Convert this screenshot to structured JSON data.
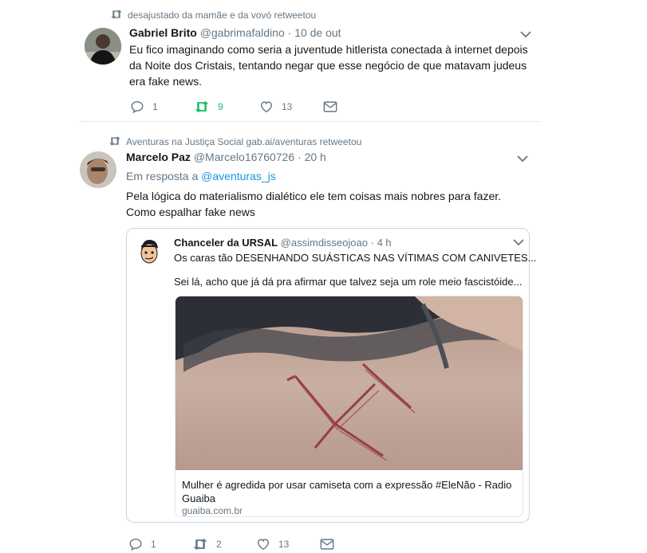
{
  "tweets": [
    {
      "retweeted_by": "desajustado da mamãe e da vovó retweetou",
      "name": "Gabriel Brito",
      "handle": "@gabrimafaldino",
      "time": "10 de out",
      "text": "Eu fico imaginando como seria a juventude hitlerista conectada à internet depois da Noite dos Cristais, tentando negar que esse negócio de que matavam judeus era fake news.",
      "reply_count": "1",
      "retweet_count": "9",
      "like_count": "13"
    },
    {
      "retweeted_by": "Aventuras na Justiça Social gab.ai/aventuras retweetou",
      "name": "Marcelo Paz",
      "handle": "@Marcelo16760726",
      "time": "20 h",
      "reply_prefix": "Em resposta a",
      "reply_to": "@aventuras_js",
      "text": "Pela lógica do materialismo dialético ele tem coisas mais nobres para fazer. Como espalhar fake news",
      "reply_count": "1",
      "retweet_count": "2",
      "like_count": "13",
      "quote": {
        "name": "Chanceler da URSAL",
        "handle": "@assimdisseojoao",
        "time": "4 h",
        "line1": "Os caras tão DESENHANDO SUÁSTICAS NAS VÍTIMAS COM CANIVETES...",
        "line2": "Sei lá, acho que já dá pra afirmar que talvez seja um role meio fascistóide...",
        "card_title": "Mulher é agredida por usar camiseta com a expressão #EleNão - Radio Guaiba",
        "card_domain": "guaiba.com.br"
      }
    }
  ],
  "separator": "·",
  "colors": {
    "accent": "#1b95e0",
    "retweet_green": "#17bf63",
    "muted": "#657786"
  },
  "icons": [
    "retweet-icon",
    "caret-down-icon",
    "reply-icon",
    "heart-icon",
    "mail-icon"
  ]
}
